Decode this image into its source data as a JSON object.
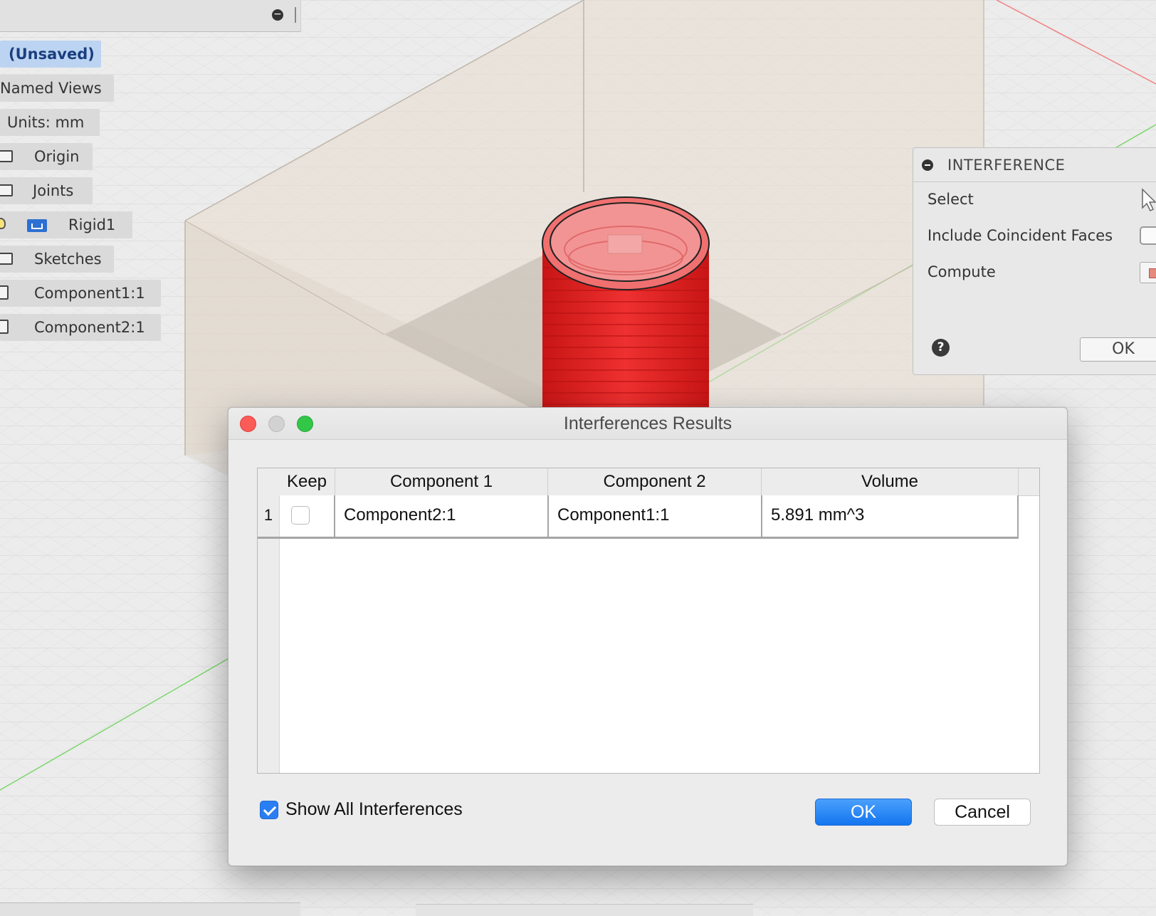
{
  "browser": {
    "items": [
      {
        "label": "(Unsaved)"
      },
      {
        "label": "Named Views"
      },
      {
        "label": "Units: mm"
      },
      {
        "label": "Origin"
      },
      {
        "label": "Joints"
      },
      {
        "label": "Rigid1"
      },
      {
        "label": "Sketches"
      },
      {
        "label": "Component1:1"
      },
      {
        "label": "Component2:1"
      }
    ]
  },
  "interference_panel": {
    "title": "INTERFERENCE",
    "select_label": "Select",
    "coincident_label": "Include Coincident Faces",
    "compute_label": "Compute",
    "ok_label": "OK",
    "help_label": "?"
  },
  "dialog": {
    "title": "Interferences Results",
    "columns": [
      "Keep",
      "Component 1",
      "Component 2",
      "Volume"
    ],
    "rows": [
      {
        "num": "1",
        "keep": false,
        "component1": "Component2:1",
        "component2": "Component1:1",
        "volume": "5.891 mm^3"
      }
    ],
    "show_all_label": "Show All Interferences",
    "show_all_checked": true,
    "ok_label": "OK",
    "cancel_label": "Cancel"
  },
  "colors": {
    "accent": "#1475f0",
    "interference_red": "#e21f1f",
    "root_highlight": "#bcd4f1"
  }
}
